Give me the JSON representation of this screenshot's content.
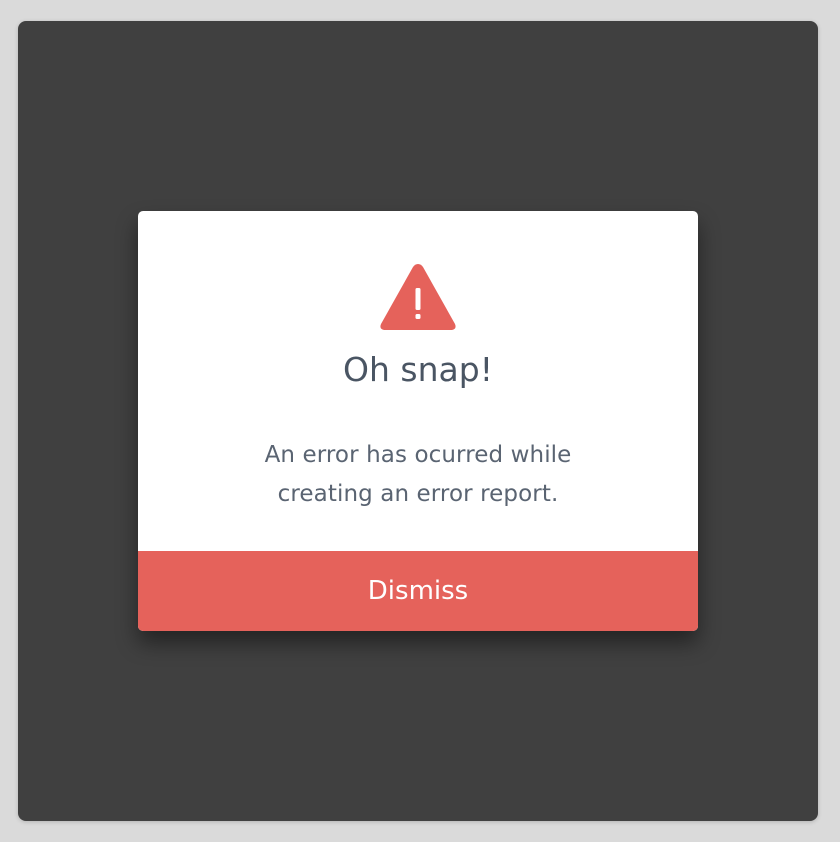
{
  "dialog": {
    "icon": "warning-triangle-icon",
    "title": "Oh snap!",
    "message_lines": [
      "An error has ocurred while",
      "creating an error report."
    ],
    "dismiss_label": "Dismiss"
  },
  "colors": {
    "accent": "#e5625b",
    "backdrop": "#404040",
    "title_text": "#4a5563",
    "page_background": "#dadada"
  }
}
